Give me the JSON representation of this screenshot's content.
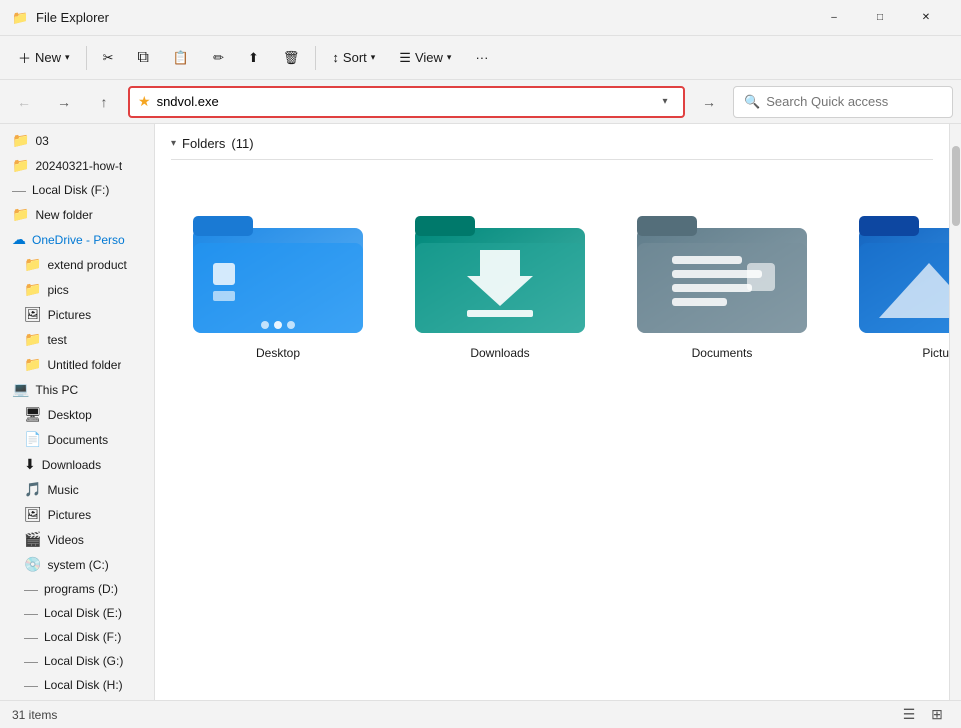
{
  "titleBar": {
    "icon": "📁",
    "title": "File Explorer",
    "minimize": "–",
    "maximize": "□",
    "close": "✕"
  },
  "toolbar": {
    "new_label": "New",
    "cut_icon": "✂",
    "copy_icon": "⧉",
    "paste_icon": "📋",
    "rename_icon": "✏",
    "share_icon": "⬆",
    "delete_icon": "🗑",
    "sort_label": "Sort",
    "view_label": "View",
    "more_icon": "···"
  },
  "addressBar": {
    "back_icon": "←",
    "forward_icon": "→",
    "up_icon": "↑",
    "star_icon": "★",
    "address_value": "sndvol.exe",
    "go_icon": "→",
    "search_placeholder": "Search Quick access"
  },
  "sidebar": {
    "items": [
      {
        "id": "item-03",
        "icon": "📁",
        "label": "03",
        "indent": 0
      },
      {
        "id": "item-20240321",
        "icon": "📁",
        "label": "20240321-how-t",
        "indent": 0
      },
      {
        "id": "item-localdisk-f1",
        "icon": "—",
        "label": "Local Disk (F:)",
        "indent": 0
      },
      {
        "id": "item-newfolder",
        "icon": "📁",
        "label": "New folder",
        "indent": 0
      },
      {
        "id": "item-onedrive",
        "icon": "☁",
        "label": "OneDrive - Perso",
        "indent": 0,
        "color": "#0078d4"
      },
      {
        "id": "item-extendproduct",
        "icon": "📁",
        "label": "extend product",
        "indent": 1
      },
      {
        "id": "item-pics",
        "icon": "📁",
        "label": "pics",
        "indent": 1
      },
      {
        "id": "item-pictures",
        "icon": "🖼",
        "label": "Pictures",
        "indent": 1
      },
      {
        "id": "item-test",
        "icon": "📁",
        "label": "test",
        "indent": 1
      },
      {
        "id": "item-untitled",
        "icon": "📁",
        "label": "Untitled folder",
        "indent": 1
      },
      {
        "id": "item-thispc",
        "icon": "💻",
        "label": "This PC",
        "indent": 0,
        "color": "#1a1a1a"
      },
      {
        "id": "item-desktop",
        "icon": "🖥",
        "label": "Desktop",
        "indent": 1
      },
      {
        "id": "item-documents",
        "icon": "📄",
        "label": "Documents",
        "indent": 1
      },
      {
        "id": "item-downloads",
        "icon": "⬇",
        "label": "Downloads",
        "indent": 1
      },
      {
        "id": "item-music",
        "icon": "🎵",
        "label": "Music",
        "indent": 1
      },
      {
        "id": "item-pictures2",
        "icon": "🖼",
        "label": "Pictures",
        "indent": 1
      },
      {
        "id": "item-videos",
        "icon": "🎬",
        "label": "Videos",
        "indent": 1
      },
      {
        "id": "item-systemc",
        "icon": "💿",
        "label": "system (C:)",
        "indent": 1
      },
      {
        "id": "item-programsd",
        "icon": "—",
        "label": "programs (D:)",
        "indent": 1
      },
      {
        "id": "item-localdiskie",
        "icon": "—",
        "label": "Local Disk (E:)",
        "indent": 1
      },
      {
        "id": "item-localdiskf",
        "icon": "—",
        "label": "Local Disk (F:)",
        "indent": 1
      },
      {
        "id": "item-localdiskg",
        "icon": "—",
        "label": "Local Disk (G:)",
        "indent": 1
      },
      {
        "id": "item-localdiskh",
        "icon": "—",
        "label": "Local Disk (H:)",
        "indent": 1
      }
    ]
  },
  "content": {
    "folders_label": "Folders",
    "folders_count": "(11)",
    "folders": [
      {
        "id": "desktop",
        "name": "Desktop",
        "type": "desktop"
      },
      {
        "id": "downloads",
        "name": "Downloads",
        "type": "downloads"
      },
      {
        "id": "documents",
        "name": "Documents",
        "type": "documents"
      },
      {
        "id": "pictures",
        "name": "Pictures",
        "type": "pictures"
      }
    ]
  },
  "statusBar": {
    "items_label": "31 items",
    "view_list": "☰",
    "view_grid": "⊞"
  }
}
